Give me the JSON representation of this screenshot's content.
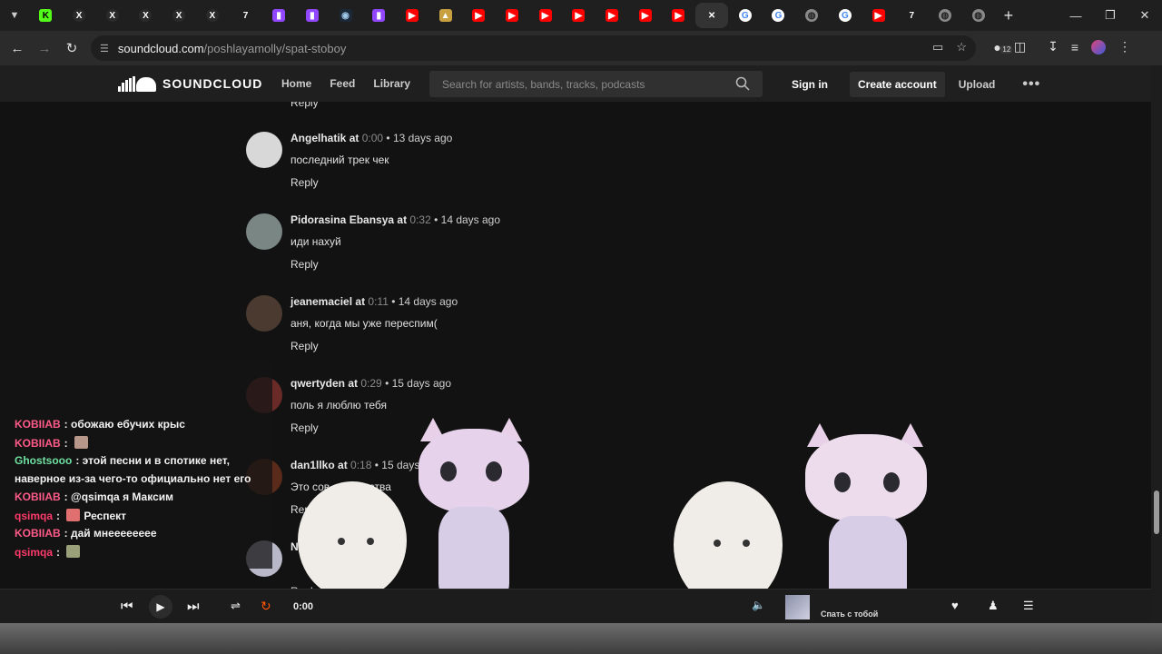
{
  "browser": {
    "tab_favicons": [
      "kick",
      "x",
      "x",
      "x",
      "x",
      "x",
      "tiktok-like",
      "twitch",
      "twitch",
      "steam",
      "twitch",
      "youtube",
      "youtube-alt",
      "youtube",
      "youtube",
      "youtube",
      "youtube",
      "youtube",
      "youtube",
      "youtube",
      "soundcloud-active",
      "google",
      "google",
      "globe",
      "google",
      "youtube",
      "tiktok-like",
      "globe",
      "globe"
    ],
    "new_tab": "+",
    "url_host": "soundcloud.com",
    "url_path": "/poshlayamolly/spat-stoboy",
    "badge_count": "12"
  },
  "header": {
    "logo_text": "SOUNDCLOUD",
    "nav": [
      "Home",
      "Feed",
      "Library"
    ],
    "search_placeholder": "Search for artists, bands, tracks, podcasts",
    "signin": "Sign in",
    "create_account": "Create account",
    "upload": "Upload",
    "more": "•••"
  },
  "comments": {
    "top_reply": "Reply",
    "reply_label": "Reply",
    "items": [
      {
        "user": "Angelhatik",
        "at": "at",
        "time": "0:00",
        "ago": "• 13 days ago",
        "text": "последний трек чек",
        "avatar_color": "#d8d8d8"
      },
      {
        "user": "Pidorasina Ebansya",
        "at": "at",
        "time": "0:32",
        "ago": "• 14 days ago",
        "text": "иди нахуй",
        "avatar_color": "#7a8684"
      },
      {
        "user": "jeanemaciel",
        "at": "at",
        "time": "0:11",
        "ago": "• 14 days ago",
        "text": "аня, когда мы уже переспим(",
        "avatar_color": "#4a3a30"
      },
      {
        "user": "qwertyden",
        "at": "at",
        "time": "0:29",
        "ago": "• 15 days ago",
        "text": "поль я люблю тебя",
        "avatar_color": "#6a2a28"
      },
      {
        "user": "dan1llko",
        "at": "at",
        "time": "0:18",
        "ago": "• 15 days ago",
        "text": "Это сов... искусства",
        "avatar_color": "#5a2a1a"
      },
      {
        "user": "Nik",
        "at": "",
        "time": "",
        "ago": "",
        "text": "",
        "avatar_color": "#b8b8c8"
      }
    ]
  },
  "chat": [
    {
      "who": "KOBIIAB",
      "color": "#ff5a88",
      "msg": "обожаю ебучих крыс",
      "emote": ""
    },
    {
      "who": "KOBIIAB",
      "color": "#ff5a88",
      "msg": "",
      "emote": "#b8988a"
    },
    {
      "who": "Ghostsooo",
      "color": "#6fe0a0",
      "msg": "этой песни и в спотике нет,",
      "emote": ""
    },
    {
      "who": "",
      "color": "#f2f2f2",
      "msg": "наверное из-за чего-то официально нет его",
      "emote": ""
    },
    {
      "who": "KOBIIAB",
      "color": "#ff5a88",
      "msg": "@qsimqa я Максим",
      "emote": ""
    },
    {
      "who": "qsimqa",
      "color": "#ff3a6a",
      "msg": "Респект",
      "emote": "#e07070"
    },
    {
      "who": "KOBIIAB",
      "color": "#ff5a88",
      "msg": "дай мнееееееее",
      "emote": ""
    },
    {
      "who": "qsimqa",
      "color": "#ff3a6a",
      "msg": "",
      "emote": "#9aa07a"
    }
  ],
  "player": {
    "time": "0:00",
    "track_title": "Спать с тобой"
  }
}
